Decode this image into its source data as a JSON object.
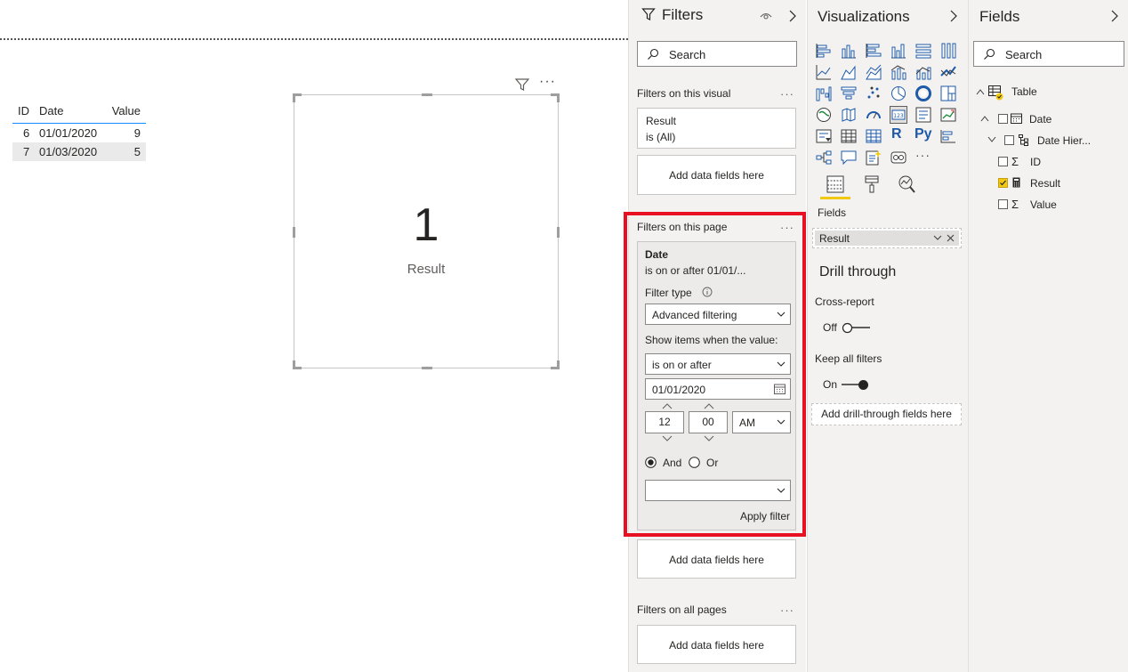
{
  "table": {
    "headers": [
      "ID",
      "Date",
      "Value"
    ],
    "rows": [
      {
        "id": "6",
        "date": "01/01/2020",
        "value": "9"
      },
      {
        "id": "7",
        "date": "01/03/2020",
        "value": "5"
      }
    ]
  },
  "card": {
    "value": "1",
    "label": "Result",
    "more": "···"
  },
  "filters": {
    "title": "Filters",
    "search_placeholder": "Search",
    "visual_section": "Filters on this visual",
    "visual_filter_name": "Result",
    "visual_filter_state": "is (All)",
    "add_fields": "Add data fields here",
    "page_section": "Filters on this page",
    "page_filter_name": "Date",
    "page_filter_summary": "is on or after 01/01/...",
    "filter_type_label": "Filter type",
    "filter_type_value": "Advanced filtering",
    "show_items_label": "Show items when the value:",
    "condition_value": "is on or after",
    "date_value": "01/01/2020",
    "hour": "12",
    "minute": "00",
    "ampm": "AM",
    "and_label": "And",
    "or_label": "Or",
    "second_condition_value": "",
    "apply_label": "Apply filter",
    "all_pages_section": "Filters on all pages",
    "dots": "···"
  },
  "visualizations": {
    "title": "Visualizations",
    "fields_tab_label": "Fields",
    "field_well_value": "Result",
    "drill_title": "Drill through",
    "cross_report_label": "Cross-report",
    "cross_report_state": "Off",
    "keep_filters_label": "Keep all filters",
    "keep_filters_state": "On",
    "add_drill_fields": "Add drill-through fields here",
    "more_visuals": "···",
    "r_label": "R",
    "py_label": "Py"
  },
  "fields_pane": {
    "title": "Fields",
    "search_placeholder": "Search",
    "table_name": "Table",
    "items": [
      {
        "name": "Date",
        "checked": false
      },
      {
        "name": "Date Hier...",
        "checked": false
      },
      {
        "name": "ID",
        "checked": false
      },
      {
        "name": "Result",
        "checked": true
      },
      {
        "name": "Value",
        "checked": false
      }
    ]
  },
  "colors": {
    "accent_yellow": "#f2c811",
    "highlight_red": "#e81123",
    "table_header_line": "#118dff",
    "pane_background": "#f3f2f1"
  }
}
